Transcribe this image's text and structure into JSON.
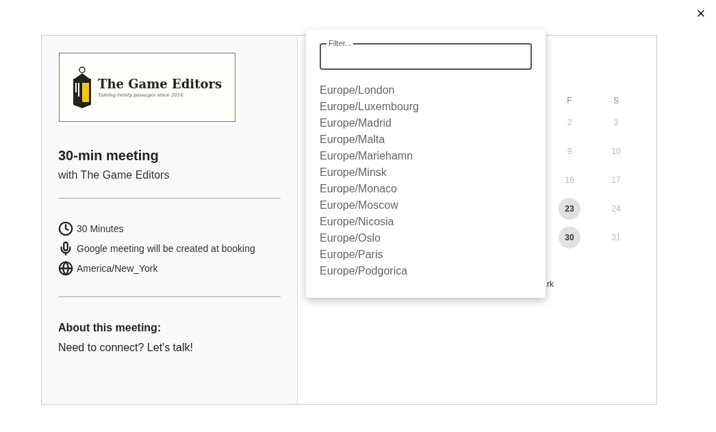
{
  "close_button": {
    "label": "×"
  },
  "logo": {
    "name": "The Game Editors",
    "tagline": "Taming twisty passages since 2016"
  },
  "meeting": {
    "title": "30-min meeting",
    "host": "with The Game Editors"
  },
  "details": [
    {
      "kind": "duration",
      "text": "30 Minutes"
    },
    {
      "kind": "location",
      "text": "Google meeting will be created at booking"
    },
    {
      "kind": "timezone",
      "text": "America/New_York"
    }
  ],
  "about": {
    "heading": "About this meeting:",
    "text": "Need to connect? Let's talk!"
  },
  "calendar": {
    "weekdays": [
      "F",
      "S"
    ],
    "weeks": [
      [
        {
          "day": "2",
          "available": false
        },
        {
          "day": "3",
          "available": false
        }
      ],
      [
        {
          "day": "9",
          "available": false
        },
        {
          "day": "10",
          "available": false
        }
      ],
      [
        {
          "day": "16",
          "available": false
        },
        {
          "day": "17",
          "available": false
        }
      ],
      [
        {
          "day": "23",
          "available": true
        },
        {
          "day": "24",
          "available": false
        }
      ],
      [
        {
          "day": "30",
          "available": true
        },
        {
          "day": "31",
          "available": false
        }
      ]
    ],
    "timezone_fragment": "rk"
  },
  "timezone_dropdown": {
    "filter": {
      "placeholder": "Filter..."
    },
    "options": [
      "Europe/London",
      "Europe/Luxembourg",
      "Europe/Madrid",
      "Europe/Malta",
      "Europe/Mariehamn",
      "Europe/Minsk",
      "Europe/Monaco",
      "Europe/Moscow",
      "Europe/Nicosia",
      "Europe/Oslo",
      "Europe/Paris",
      "Europe/Podgorica"
    ]
  }
}
